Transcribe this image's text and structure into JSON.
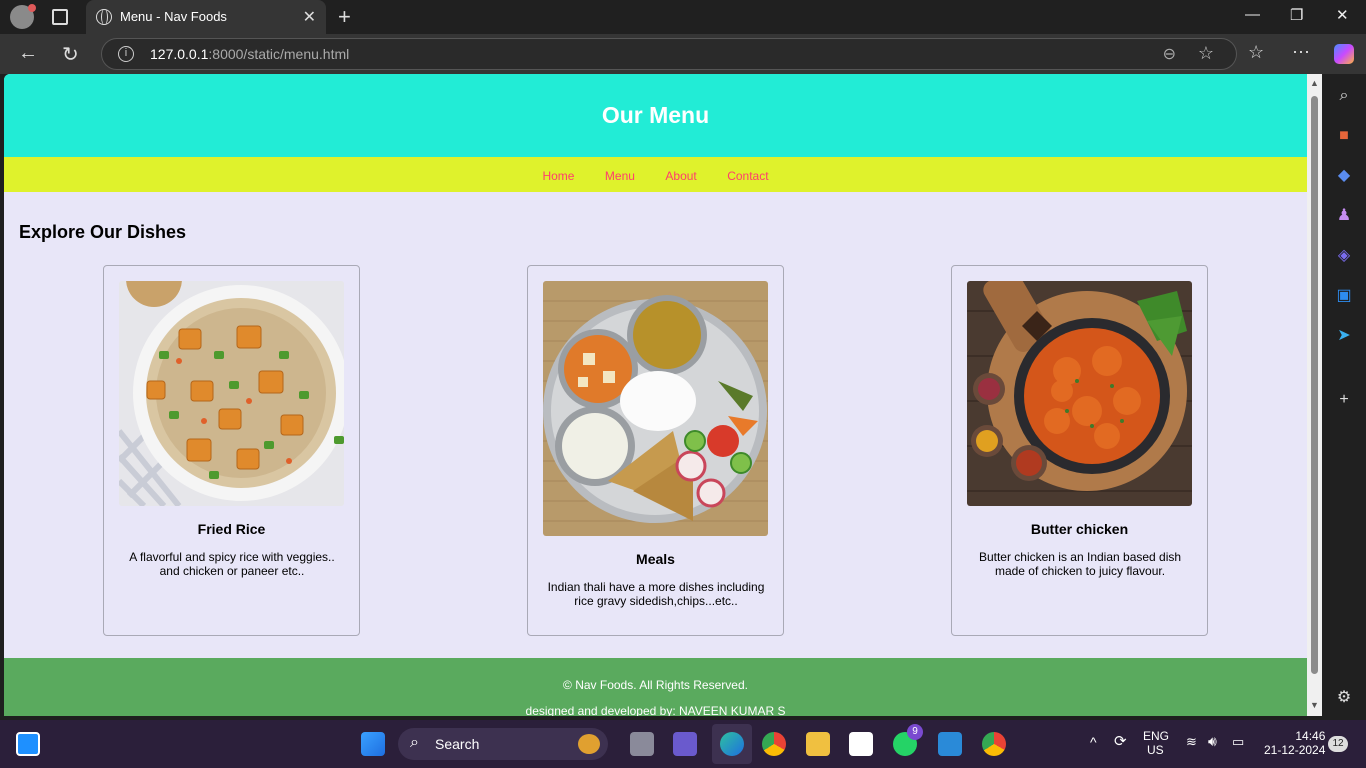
{
  "browser": {
    "tab_title": "Menu - Nav Foods",
    "url_host": "127.0.0.1",
    "url_path": ":8000/static/menu.html"
  },
  "site": {
    "header_title": "Our Menu",
    "nav": [
      "Home",
      "Menu",
      "About",
      "Contact"
    ],
    "section_title": "Explore Our Dishes",
    "dishes": [
      {
        "name": "Fried Rice",
        "description": "A flavorful and spicy rice with veggies.. and chicken or paneer etc.."
      },
      {
        "name": "Meals",
        "description": "Indian thali have a more dishes including rice gravy sidedish,chips...etc.."
      },
      {
        "name": "Butter chicken",
        "description": "Butter chicken is an Indian based dish made of chicken to juicy flavour."
      }
    ],
    "footer_line1": "© Nav Foods. All Rights Reserved.",
    "footer_line2": "designed and developed by: NAVEEN KUMAR S"
  },
  "taskbar": {
    "search_label": "Search",
    "whatsapp_badge": "9",
    "lang": "ENG",
    "region": "US",
    "time": "14:46",
    "date": "21-12-2024",
    "notif_count": "12"
  }
}
